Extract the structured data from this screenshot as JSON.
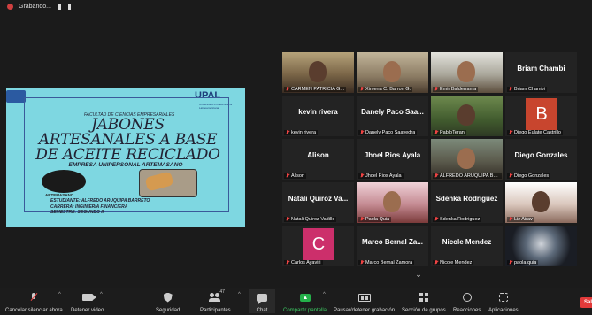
{
  "topbar": {
    "status": "Grabando..."
  },
  "slide": {
    "university": "UPAL",
    "university_sub": "Universidad Privada Abierta Latinoamericana",
    "faculty": "FACULTAD DE CIENCIAS EMPRESARIALES",
    "title": "JABONES ARTESANALES A BASE DE ACEITE RECICLADO",
    "company": "EMPRESA UNIPERSONAL ARTEMASANO",
    "logo_text": "ARTEMASANO",
    "student_line": "ESTUDIANTE: ALFREDO ARUQUIPA BARRETO",
    "career_line": "CARRERA: INGINIERIA FINANCIERA",
    "semester_line": "SEMESTRE: SEGUNDO II"
  },
  "participants": [
    {
      "name": "CARMEN PATRICIA G...",
      "display": "",
      "video": "v1"
    },
    {
      "name": "Ximena C. Barron G.",
      "display": "",
      "video": "v2"
    },
    {
      "name": "Emir Balderrama",
      "display": "",
      "video": "v3"
    },
    {
      "name": "Briam Chambi",
      "display": "Briam Chambi",
      "video": ""
    },
    {
      "name": "kevin rivera",
      "display": "kevin rivera",
      "video": ""
    },
    {
      "name": "Danely Paco Saavedra",
      "display": "Danely Paco Saa...",
      "video": ""
    },
    {
      "name": "PabloTeran",
      "display": "",
      "video": "v4"
    },
    {
      "name": "Diego Eulate Castrillo",
      "display": "",
      "video": "",
      "letter": "B",
      "letter_color": "#c8452e"
    },
    {
      "name": "Alison",
      "display": "Alison",
      "video": ""
    },
    {
      "name": "Jhoel Rios Ayala",
      "display": "Jhoel Rios Ayala",
      "video": ""
    },
    {
      "name": "ALFREDO ARUQUIPA BA...",
      "display": "",
      "video": "v5",
      "active": true
    },
    {
      "name": "Diego Gonzales",
      "display": "Diego Gonzales",
      "video": ""
    },
    {
      "name": "Natali Quiroz Vadillo",
      "display": "Natali Quiroz Va...",
      "video": ""
    },
    {
      "name": "Paola Quia",
      "display": "",
      "video": "v6"
    },
    {
      "name": "Sdenka Rodriguez",
      "display": "Sdenka Rodriguez",
      "video": ""
    },
    {
      "name": "Liz Airav",
      "display": "",
      "video": "v7"
    },
    {
      "name": "Carlos Ayaviri",
      "display": "",
      "video": "",
      "letter": "C",
      "letter_color": "#cc2f6b"
    },
    {
      "name": "Marco Bernal Zamora",
      "display": "Marco Bernal Za...",
      "video": ""
    },
    {
      "name": "Nicole Mendez",
      "display": "Nicole Mendez",
      "video": ""
    },
    {
      "name": "paola quia",
      "display": "",
      "video": "v8"
    }
  ],
  "toolbar": {
    "unmute": "Cancelar silenciar ahora",
    "stop_video": "Detener video",
    "security": "Seguridad",
    "participants": "Participantes",
    "participants_count": "47",
    "chat": "Chat",
    "share": "Compartir pantalla",
    "record": "Pausar/detener grabación",
    "breakout": "Sección de grupos",
    "reactions": "Reacciones",
    "apps": "Aplicaciones",
    "end": "Sali"
  },
  "colors": {
    "accent_green": "#24b04a",
    "end_red": "#e23a3a",
    "active_outline": "#9fd25a"
  }
}
